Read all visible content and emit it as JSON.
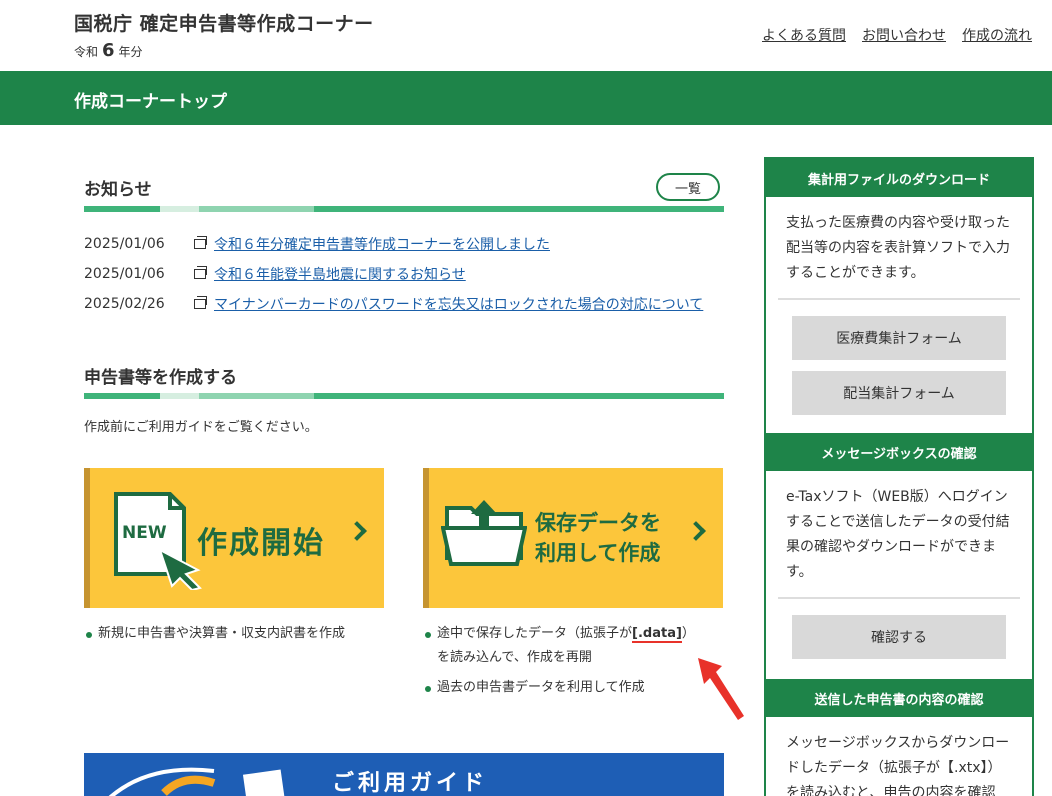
{
  "header": {
    "title": "国税庁 確定申告書等作成コーナー",
    "era": "令和",
    "year": "6",
    "year_suffix": "年分",
    "links": [
      "よくある質問",
      "お問い合わせ",
      "作成の流れ"
    ]
  },
  "topbar": {
    "title": "作成コーナートップ"
  },
  "news": {
    "title": "お知らせ",
    "list_button": "一覧",
    "items": [
      {
        "date": "2025/01/06",
        "text": "令和６年分確定申告書等作成コーナーを公開しました"
      },
      {
        "date": "2025/01/06",
        "text": "令和６年能登半島地震に関するお知らせ"
      },
      {
        "date": "2025/02/26",
        "text": "マイナンバーカードのパスワードを忘失又はロックされた場合の対応について"
      }
    ]
  },
  "create": {
    "title": "申告書等を作成する",
    "guide_text": "作成前にご利用ガイドをご覧ください。",
    "new_tile": {
      "badge": "NEW",
      "label": "作成開始"
    },
    "save_tile": {
      "label_line1": "保存データを",
      "label_line2": "利用して作成"
    },
    "new_bullets": [
      "新規に申告書や決算書・収支内訳書を作成"
    ],
    "save_bullets": {
      "line1_pre": "途中で保存したデータ（拡張子が",
      "line1_ext": "[.data]",
      "line1_post": "）",
      "line1_cont": "を読み込んで、作成を再開",
      "line2": "過去の申告書データを利用して作成"
    },
    "guide_banner": "ご利用ガイド"
  },
  "side": {
    "download": {
      "title": "集計用ファイルのダウンロード",
      "text": "支払った医療費の内容や受け取った配当等の内容を表計算ソフトで入力することができます。",
      "buttons": [
        "医療費集計フォーム",
        "配当集計フォーム"
      ]
    },
    "messagebox": {
      "title": "メッセージボックスの確認",
      "text": "e-Taxソフト（WEB版）へログインすることで送信したデータの受付結果の確認やダウンロードができます。",
      "button": "確認する"
    },
    "sent": {
      "title": "送信した申告書の内容の確認",
      "text": "メッセージボックスからダウンロードしたデータ（拡張子が【.xtx】）を読み込むと、申告の内容を確認"
    }
  },
  "colors": {
    "brand_green": "#1e8449",
    "tile_yellow": "#fcc63b",
    "link_blue": "#1a5ea8",
    "guide_blue": "#1e5eb5",
    "annotation_red": "#e8322a"
  }
}
